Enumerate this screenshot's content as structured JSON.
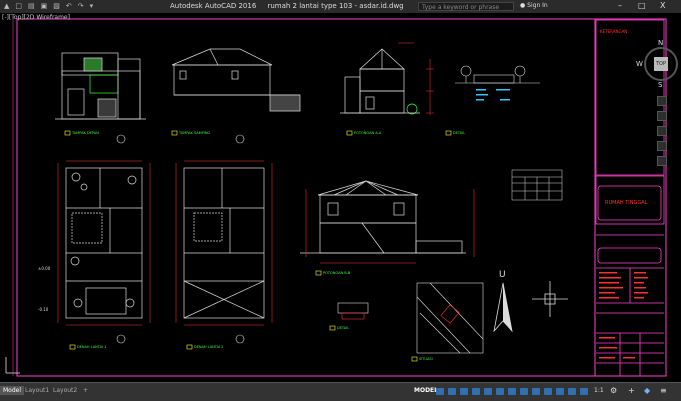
{
  "window": {
    "app_title": "Autodesk AutoCAD 2016",
    "file_title": "rumah 2 lantai type 103 - asdar.id.dwg",
    "search_placeholder": "Type a keyword or phrase",
    "sign_in": "Sign In",
    "minimize": "–",
    "maximize": "□",
    "close": "X"
  },
  "viewport": {
    "label": "[-][Top][2D Wireframe]"
  },
  "viewcube": {
    "top": "TOP",
    "north": "N",
    "south": "S",
    "west": "W"
  },
  "drawing": {
    "labels": {
      "tampak_depan": "TAMPAK DEPAN",
      "tampak_samping": "TAMPAK SAMPING",
      "potongan_aa": "POTONGAN A-A",
      "detail": "DETAIL",
      "denah_lantai1": "DENAH LANTAI 1",
      "denah_lantai2": "DENAH LANTAI 2",
      "potongan_bb": "POTONGAN B-B",
      "detail2": "DETAIL",
      "situasi": "SITUASI",
      "north_arrow": "U",
      "level_1": "±0.00",
      "level_2": "-0.10",
      "title_block_header": "KETERANGAN",
      "title_block_project": "RUMAH TINGGAL"
    }
  },
  "statusbar": {
    "tabs": [
      "Model",
      "Layout1",
      "Layout2",
      "+"
    ],
    "model_button": "MODEL",
    "scale": "1:1"
  },
  "colors": {
    "background": "#000000",
    "titlebar": "#2b2b2b",
    "statusbar": "#333333",
    "frame_border": "#ff3fcf",
    "drawing_lines": "#dcdcdc",
    "annotation_red": "#ff3030",
    "annotation_green": "#39ff3a",
    "annotation_yellow": "#ffff33",
    "annotation_cyan": "#30c6ff"
  }
}
